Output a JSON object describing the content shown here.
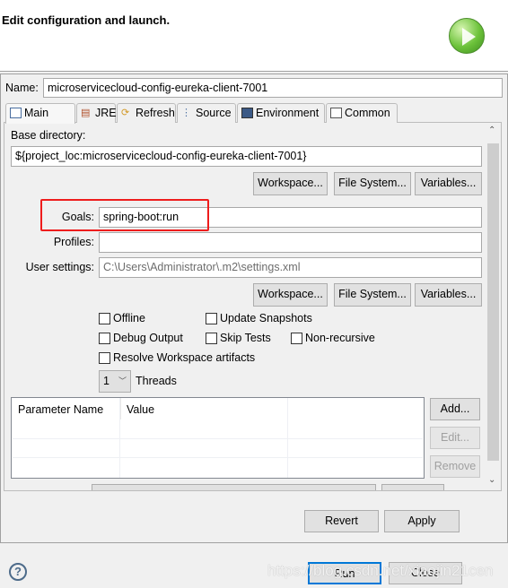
{
  "header": {
    "title": "Edit configuration and launch.",
    "icon": "run-launch-icon"
  },
  "name": {
    "label": "Name:",
    "value": "microservicecloud-config-eureka-client-7001"
  },
  "tabs": [
    {
      "label": "Main",
      "icon": "main-tab-icon",
      "selected": true
    },
    {
      "label": "JRE",
      "icon": "jre-icon"
    },
    {
      "label": "Refresh",
      "icon": "refresh-icon"
    },
    {
      "label": "Source",
      "icon": "source-icon"
    },
    {
      "label": "Environment",
      "icon": "environment-icon"
    },
    {
      "label": "Common",
      "icon": "common-icon"
    }
  ],
  "main": {
    "base_directory_label": "Base directory:",
    "base_directory_value": "${project_loc:microservicecloud-config-eureka-client-7001}",
    "buttons1": {
      "workspace": "Workspace...",
      "file_system": "File System...",
      "variables": "Variables..."
    },
    "goals_label": "Goals:",
    "goals_value": "spring-boot:run",
    "profiles_label": "Profiles:",
    "profiles_value": "",
    "user_settings_label": "User settings:",
    "user_settings_value": "C:\\Users\\Administrator\\.m2\\settings.xml",
    "buttons2": {
      "workspace": "Workspace...",
      "file_system": "File System...",
      "variables": "Variables..."
    },
    "checkboxes": {
      "offline": "Offline",
      "update_snapshots": "Update Snapshots",
      "debug_output": "Debug Output",
      "skip_tests": "Skip Tests",
      "non_recursive": "Non-recursive",
      "resolve_workspace": "Resolve Workspace artifacts"
    },
    "threads_value": "1",
    "threads_label": "Threads",
    "table": {
      "columns": [
        "Parameter Name",
        "Value"
      ],
      "rows": []
    },
    "table_buttons": {
      "add": "Add...",
      "edit": "Edit...",
      "remove": "Remove"
    }
  },
  "footer": {
    "revert": "Revert",
    "apply": "Apply",
    "run": "Run",
    "close": "Close"
  },
  "watermark": "https://blog.csdn.net/xiaojin21cen",
  "colors": {
    "highlight": "#ee1c1c",
    "default_button_border": "#0078d7"
  }
}
